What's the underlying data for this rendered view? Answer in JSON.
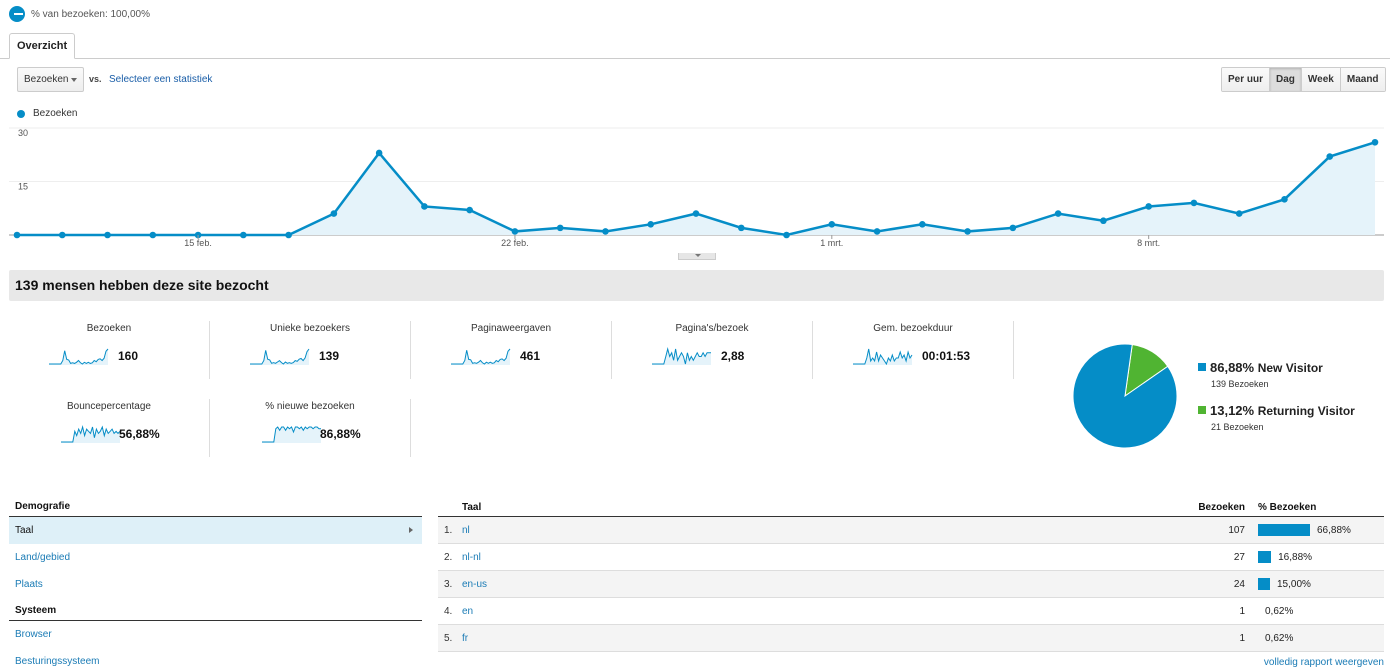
{
  "segment": {
    "label": "% van bezoeken: 100,00%"
  },
  "tabs": [
    {
      "label": "Overzicht"
    }
  ],
  "controls": {
    "metric_select": "Bezoeken",
    "vs_label": "vs.",
    "compare_link": "Selecteer een statistiek",
    "periods": [
      "Per uur",
      "Dag",
      "Week",
      "Maand"
    ],
    "active_period": "Dag"
  },
  "chart_data": {
    "type": "area",
    "legend": "Bezoeken",
    "series": [
      {
        "name": "Bezoeken",
        "values": [
          0,
          0,
          0,
          0,
          0,
          0,
          0,
          6,
          23,
          8,
          7,
          1,
          2,
          1,
          3,
          6,
          2,
          0,
          3,
          1,
          3,
          1,
          2,
          6,
          4,
          8,
          9,
          6,
          10,
          22,
          26
        ]
      }
    ],
    "ylim": [
      0,
      30
    ],
    "yticks": [
      30,
      15
    ],
    "xtick_labels": [
      "15 feb.",
      "22 feb.",
      "1 mrt.",
      "8 mrt."
    ],
    "xtick_index": [
      4,
      11,
      18,
      25
    ],
    "color": "#058dc7",
    "grid": true
  },
  "summary": {
    "title": "139 mensen hebben deze site bezocht"
  },
  "metrics": [
    {
      "title": "Bezoeken",
      "value": "160",
      "spark": [
        0,
        0,
        0,
        0,
        0,
        0,
        0,
        6,
        23,
        8,
        7,
        1,
        2,
        1,
        3,
        6,
        2,
        0,
        3,
        1,
        3,
        1,
        2,
        6,
        4,
        8,
        9,
        6,
        10,
        22,
        26
      ]
    },
    {
      "title": "Unieke bezoekers",
      "value": "139",
      "spark": [
        0,
        0,
        0,
        0,
        0,
        0,
        0,
        5,
        20,
        7,
        6,
        1,
        2,
        1,
        3,
        5,
        2,
        0,
        3,
        1,
        2,
        1,
        2,
        5,
        4,
        7,
        8,
        5,
        9,
        18,
        22
      ]
    },
    {
      "title": "Paginaweergaven",
      "value": "461",
      "spark": [
        0,
        0,
        0,
        0,
        0,
        0,
        0,
        15,
        60,
        20,
        18,
        3,
        5,
        3,
        8,
        15,
        5,
        0,
        8,
        3,
        8,
        3,
        5,
        15,
        10,
        20,
        22,
        15,
        25,
        55,
        65
      ]
    },
    {
      "title": "Pagina's/bezoek",
      "value": "2,88",
      "spark": [
        0,
        0,
        0,
        0,
        0,
        0,
        0,
        2,
        4,
        2,
        3,
        1,
        4,
        1,
        2,
        3,
        2,
        0,
        3,
        1,
        2,
        1,
        2,
        3,
        2,
        2,
        3,
        2,
        3,
        3,
        3
      ]
    },
    {
      "title": "Gem. bezoekduur",
      "value": "00:01:53",
      "spark": [
        0,
        0,
        0,
        0,
        0,
        0,
        0,
        2,
        5,
        1,
        2,
        1,
        4,
        1,
        3,
        2,
        1,
        0,
        2,
        1,
        3,
        1,
        2,
        2,
        4,
        2,
        3,
        1,
        4,
        2,
        3
      ]
    },
    {
      "title": "Bouncepercentage",
      "value": "56,88%",
      "spark": [
        0,
        0,
        0,
        0,
        0,
        0,
        0,
        5,
        3,
        6,
        4,
        7,
        3,
        6,
        5,
        4,
        7,
        2,
        6,
        4,
        5,
        7,
        3,
        6,
        4,
        5,
        6,
        4,
        5,
        4,
        5
      ]
    },
    {
      "title": "% nieuwe bezoeken",
      "value": "86,88%",
      "spark": [
        0,
        0,
        0,
        0,
        0,
        0,
        0,
        8,
        9,
        7,
        9,
        9,
        7,
        9,
        8,
        9,
        6,
        9,
        9,
        8,
        9,
        7,
        9,
        8,
        9,
        9,
        8,
        9,
        9,
        8,
        8
      ]
    }
  ],
  "visitor_types": [
    {
      "pct": "86,88%",
      "label": "New Visitor",
      "sub": "139 Bezoeken",
      "share": 0.8688,
      "color": "#058dc7"
    },
    {
      "pct": "13,12%",
      "label": "Returning Visitor",
      "sub": "21 Bezoeken",
      "share": 0.1312,
      "color": "#50b432"
    }
  ],
  "demographics": {
    "header1": "Demografie",
    "items1": [
      "Taal",
      "Land/gebied",
      "Plaats"
    ],
    "header2": "Systeem",
    "items2": [
      "Browser",
      "Besturingssysteem"
    ]
  },
  "language_table": {
    "headers": {
      "name": "Taal",
      "visits": "Bezoeken",
      "pct": "% Bezoeken"
    },
    "rows": [
      {
        "idx": "1.",
        "name": "nl",
        "visits": "107",
        "pct": "66,88%",
        "share": 66.88
      },
      {
        "idx": "2.",
        "name": "nl-nl",
        "visits": "27",
        "pct": "16,88%",
        "share": 16.88
      },
      {
        "idx": "3.",
        "name": "en-us",
        "visits": "24",
        "pct": "15,00%",
        "share": 15.0
      },
      {
        "idx": "4.",
        "name": "en",
        "visits": "1",
        "pct": "0,62%",
        "share": 0.62
      },
      {
        "idx": "5.",
        "name": "fr",
        "visits": "1",
        "pct": "0,62%",
        "share": 0.62
      }
    ],
    "full_report_link": "volledig rapport weergeven"
  }
}
